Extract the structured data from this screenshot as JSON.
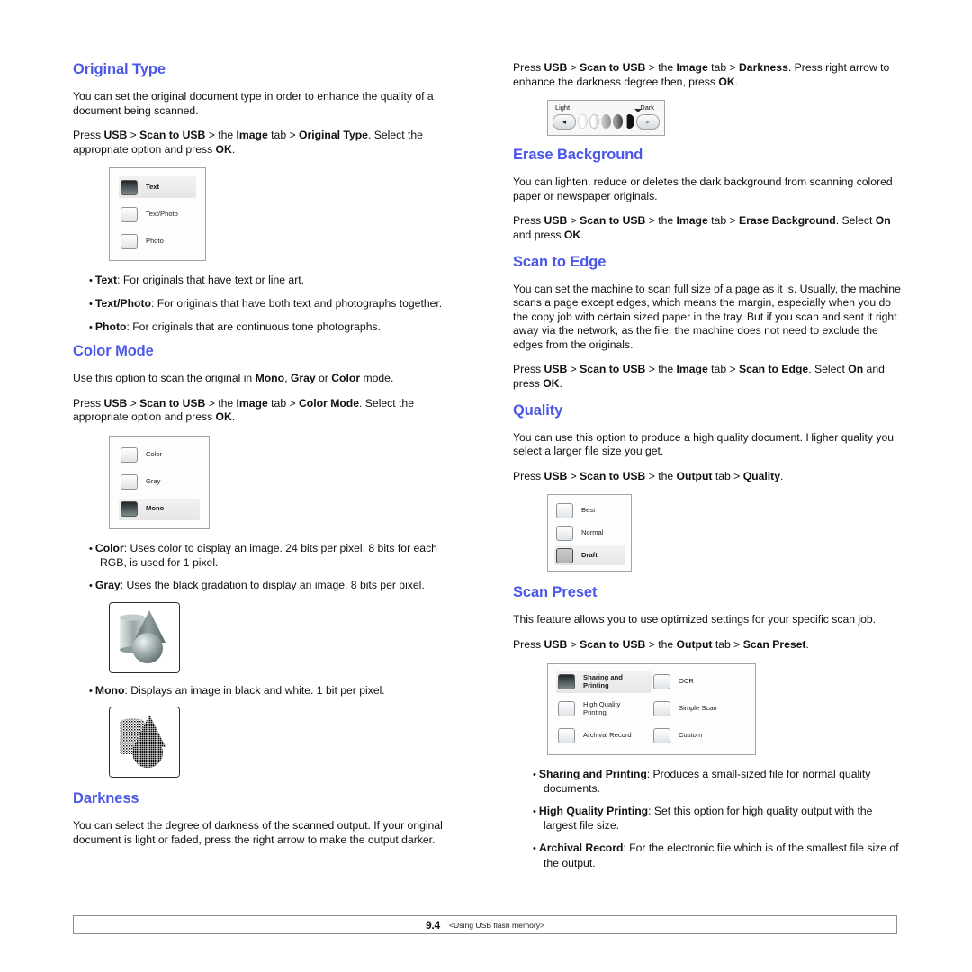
{
  "document": {
    "footer": {
      "page_number": "9.4",
      "chapter_title": "<Using USB flash memory>"
    }
  },
  "left_column": {
    "original_type": {
      "heading": "Original Type",
      "para_intro_1": "You can set the original document type in order to enhance the quality of",
      "para_intro_2": "a document being scanned.",
      "path_press": "Press ",
      "path_usb": "USB",
      "path_sep1": " > ",
      "path_scan_to_usb": "Scan to USB",
      "path_sep2": " > the ",
      "path_image": "Image",
      "path_tab": " tab > ",
      "path_option": "Original Type",
      "path_tail": ". Select the appropriate option and press ",
      "path_ok": "OK",
      "path_period": ".",
      "panel": {
        "options": [
          {
            "label": "Text",
            "selected": true
          },
          {
            "label": "Text/Photo",
            "selected": false
          },
          {
            "label": "Photo",
            "selected": false
          }
        ]
      },
      "bullets": [
        {
          "term": "Text",
          "text": ": For originals that have text or line art."
        },
        {
          "term": "Text/Photo",
          "text": ": For originals that have both text and photographs together."
        },
        {
          "term": "Photo",
          "text": ": For originals that are continuous tone photographs."
        }
      ]
    },
    "color_mode": {
      "heading": "Color Mode",
      "intro_pre": "Use this option to scan the original in ",
      "intro_mono": "Mono",
      "intro_comma": ", ",
      "intro_gray": "Gray",
      "intro_or": " or ",
      "intro_color": "Color",
      "intro_tail": " mode.",
      "path_press": "Press ",
      "path_usb": "USB",
      "path_sep1": " > ",
      "path_scan_to_usb": "Scan to USB",
      "path_sep2": " > the ",
      "path_image": "Image",
      "path_tab": " tab > ",
      "path_option": "Color Mode",
      "path_tail": ". Select the appropriate option and press ",
      "path_ok": "OK",
      "path_period": ".",
      "panel": {
        "options": [
          {
            "label": "Color",
            "selected": false
          },
          {
            "label": "Gray",
            "selected": false
          },
          {
            "label": "Mono",
            "selected": true
          }
        ]
      },
      "bullets": [
        {
          "term": "Color",
          "text": ": Uses color to display an image. 24 bits per pixel, 8 bits for each RGB, is used for 1 pixel."
        },
        {
          "term": "Gray",
          "text": ": Uses the black gradation to display an image. 8 bits per pixel."
        }
      ],
      "gray_sample_alt": "grayscale shapes sample",
      "mono_bullet": {
        "term": "Mono",
        "text": ": Displays an image in black and white. 1 bit per pixel."
      },
      "mono_sample_alt": "monochrome dithered shapes sample"
    },
    "darkness": {
      "heading": "Darkness",
      "para_1": "You can select the degree of darkness of the scanned output. If your",
      "para_2": "original document is light or faded, press the right arrow to make the",
      "para_3": "output darker."
    }
  },
  "right_column": {
    "darkness_cont": {
      "path_press": "Press ",
      "path_usb": "USB",
      "path_sep1": " > ",
      "path_scan_to_usb": "Scan to USB",
      "path_sep2": " > the ",
      "path_image": "Image",
      "path_tab": " tab > ",
      "path_option": "Darkness",
      "path_tail": ". Press right arrow to enhance the darkness degree then, press ",
      "path_ok": "OK",
      "path_period": ".",
      "slider": {
        "light_label": "Light",
        "dark_label": "Dark",
        "left_arrow": "◂",
        "right_arrow": "▸"
      }
    },
    "erase_background": {
      "heading": "Erase Background",
      "para_1": "You can lighten, reduce or deletes the dark background from scanning",
      "para_2": "colored paper or newspaper originals.",
      "path_press": "Press ",
      "path_usb": "USB",
      "path_sep1": " > ",
      "path_scan_to_usb": "Scan to USB",
      "path_sep2": " > the ",
      "path_image": "Image",
      "path_tab": " tab > ",
      "path_option": "Erase Background",
      "path_tail": ". Select ",
      "path_on": "On",
      "path_and_press": " and press ",
      "path_ok": "OK",
      "path_period": "."
    },
    "scan_to_edge": {
      "heading": "Scan to Edge",
      "para": "You can set the machine to scan full size of a page as it is. Usually, the machine scans a page except edges, which means the margin, especially when you do the copy job with certain sized paper in the tray. But if you scan and sent it right away via the network, as the file, the machine does not need to exclude the edges from the originals.",
      "path_press": "Press ",
      "path_usb": "USB",
      "path_sep1": " > ",
      "path_scan_to_usb": "Scan to USB",
      "path_sep2": " > the ",
      "path_image": "Image",
      "path_tab": " tab > ",
      "path_option": "Scan to Edge",
      "path_tail": ". Select ",
      "path_on": "On",
      "path_and_press": " and press ",
      "path_ok": "OK",
      "path_period": "."
    },
    "quality": {
      "heading": "Quality",
      "para_1": "You can use this option to produce a high quality document. Higher",
      "para_2": "quality you select a larger file size you get.",
      "path_press": "Press ",
      "path_usb": "USB",
      "path_sep1": " > ",
      "path_scan_to_usb": "Scan to USB",
      "path_sep2": " > the ",
      "path_output": "Output",
      "path_tab": " tab > ",
      "path_option": "Quality",
      "path_period": ".",
      "panel": {
        "options": [
          {
            "label": "Best",
            "selected": false
          },
          {
            "label": "Normal",
            "selected": false
          },
          {
            "label": "Draft",
            "selected": true
          }
        ]
      }
    },
    "scan_preset": {
      "heading": "Scan Preset",
      "para": "This feature allows you to use optimized settings for your specific scan job.",
      "path_press": "Press ",
      "path_usb": "USB",
      "path_sep1": " > ",
      "path_scan_to_usb": "Scan to USB",
      "path_sep2": " > the ",
      "path_output": "Output",
      "path_tab": " tab > ",
      "path_option": "Scan Preset",
      "path_period": ".",
      "panel": {
        "column_1": [
          {
            "label_line1": "Sharing and",
            "label_line2": "Printing",
            "selected": true
          },
          {
            "label_line1": "High Quality",
            "label_line2": "Printing",
            "selected": false
          },
          {
            "label_line1": "Archival Record",
            "label_line2": "",
            "selected": false
          }
        ],
        "column_2": [
          {
            "label_line1": "OCR",
            "label_line2": "",
            "selected": false
          },
          {
            "label_line1": "Simple Scan",
            "label_line2": "",
            "selected": false
          },
          {
            "label_line1": "Custom",
            "label_line2": "",
            "selected": false
          }
        ]
      },
      "bullets": [
        {
          "term": "Sharing and Printing",
          "text": ": Produces a small-sized file for normal quality documents."
        },
        {
          "term": "High Quality Printing",
          "text": ": Set this option for high quality output with the largest file size."
        },
        {
          "term": "Archival Record",
          "text": ": For the electronic file which is of the smallest file size of the output."
        }
      ]
    }
  },
  "colors": {
    "heading_blue": "#4a57e8",
    "body_black": "#111111",
    "panel_border": "#9fa5ab"
  }
}
